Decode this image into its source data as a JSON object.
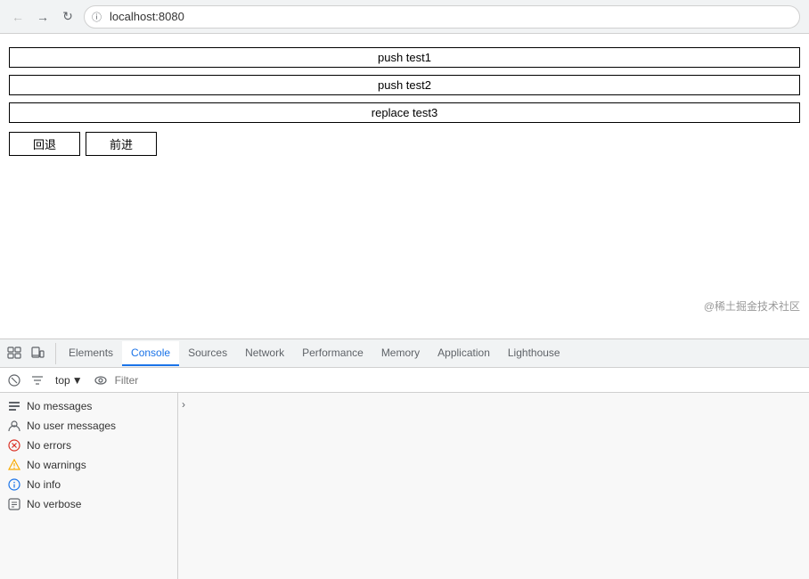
{
  "browser": {
    "url": "localhost:8080",
    "url_icon": "ℹ",
    "back_label": "←",
    "forward_label": "→",
    "refresh_label": "↻"
  },
  "page": {
    "buttons": [
      {
        "label": "push test1",
        "name": "push-test1-button"
      },
      {
        "label": "push test2",
        "name": "push-test2-button"
      },
      {
        "label": "replace test3",
        "name": "replace-test3-button"
      }
    ],
    "nav_back": "回退",
    "nav_forward": "前进",
    "watermark": "@稀土掘金技术社区"
  },
  "devtools": {
    "tabs": [
      {
        "label": "Elements",
        "active": false
      },
      {
        "label": "Console",
        "active": true
      },
      {
        "label": "Sources",
        "active": false
      },
      {
        "label": "Network",
        "active": false
      },
      {
        "label": "Performance",
        "active": false
      },
      {
        "label": "Memory",
        "active": false
      },
      {
        "label": "Application",
        "active": false
      },
      {
        "label": "Lighthouse",
        "active": false
      }
    ],
    "toolbar": {
      "top_label": "top",
      "filter_placeholder": "Filter"
    },
    "sidebar": {
      "items": [
        {
          "label": "No messages",
          "icon": "messages"
        },
        {
          "label": "No user messages",
          "icon": "user"
        },
        {
          "label": "No errors",
          "icon": "error"
        },
        {
          "label": "No warnings",
          "icon": "warning"
        },
        {
          "label": "No info",
          "icon": "info"
        },
        {
          "label": "No verbose",
          "icon": "verbose"
        }
      ]
    }
  }
}
